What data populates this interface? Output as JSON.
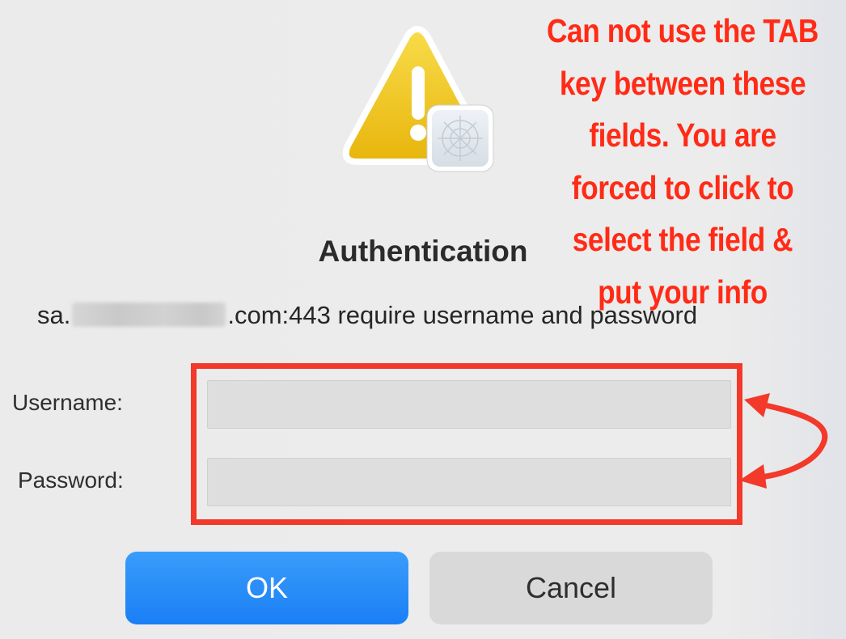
{
  "dialog": {
    "title": "Authentication",
    "message_prefix": "sa.",
    "message_suffix": ".com:443 require username and password",
    "icon": "caution-triangle-with-safari-badge-icon"
  },
  "form": {
    "username_label": "Username:",
    "username_value": "",
    "password_label": "Password:",
    "password_value": ""
  },
  "buttons": {
    "ok_label": "OK",
    "cancel_label": "Cancel"
  },
  "annotation": {
    "lines": [
      "Can not use the TAB",
      "key between these",
      "fields. You are",
      "forced to click to",
      "select the field &",
      "put your info"
    ],
    "color": "#ff2b16"
  },
  "colors": {
    "accent_button": "#1a7ff5",
    "highlight_box": "#f2392a",
    "dialog_bg": "#ececec"
  }
}
